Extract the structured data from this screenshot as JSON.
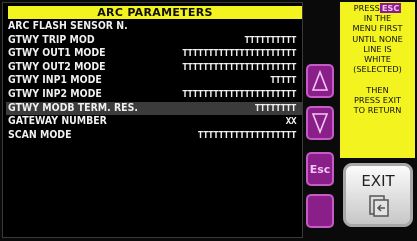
{
  "screen": {
    "title": "ARC PARAMETERS",
    "parameters": [
      {
        "label": "ARC FLASH SENSOR N.",
        "value": ""
      },
      {
        "label": "GTWY TRIP MOD",
        "value": "TTTTTTTTTT"
      },
      {
        "label": "GTWY OUT1 MODE",
        "value": "TTTTTTTTTTTTTTTTTTTTTT"
      },
      {
        "label": "GTWY OUT2 MODE",
        "value": "TTTTTTTTTTTTTTTTTTTTTT"
      },
      {
        "label": "GTWY INP1 MODE",
        "value": "TTTTT"
      },
      {
        "label": "GTWY INP2 MODE",
        "value": "TTTTTTTTTTTTTTTTTTTTTT"
      },
      {
        "label": "GTWY MODB TERM. RES.",
        "value": "TTTTTTTT"
      },
      {
        "label": "GATEWAY NUMBER",
        "value": "XX"
      },
      {
        "label": "SCAN MODE",
        "value": "TTTTTTTTTTTTTTTTTTT"
      }
    ]
  },
  "nav": {
    "up_icon": "triangle-up-icon",
    "down_icon": "triangle-down-icon",
    "esc_label": "Esc"
  },
  "help": {
    "line1_prefix": "PRESS",
    "esc_chip": "ESC",
    "lines": [
      "IN THE",
      "MENU FIRST",
      "UNTIL NONE",
      "LINE IS",
      "WHITE",
      "(SELECTED)",
      "",
      "THEN",
      "PRESS EXIT",
      "TO RETURN"
    ]
  },
  "exit": {
    "label": "EXIT",
    "icon": "exit-arrow-icon"
  },
  "colors": {
    "accent_yellow": "#f3f320",
    "button_purple": "#8a1f8a",
    "background": "#000000",
    "text": "#f0f0f0"
  }
}
